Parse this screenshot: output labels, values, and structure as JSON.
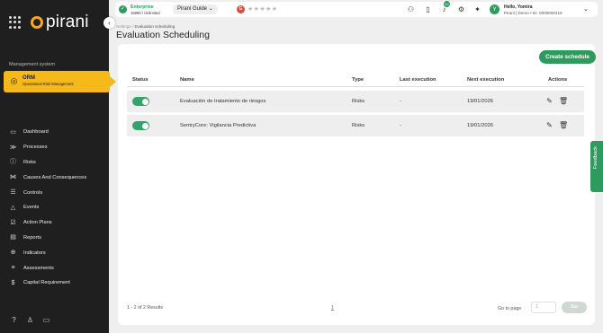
{
  "brand": {
    "name": "pirani"
  },
  "sidebar": {
    "section_label": "Management system",
    "active_module": {
      "title": "ORM",
      "subtitle": "Operational Risk Management"
    },
    "items": [
      {
        "label": "Dashboard",
        "icon": "monitor-icon"
      },
      {
        "label": "Processes",
        "icon": "processes-icon"
      },
      {
        "label": "Risks",
        "icon": "alert-circle-icon"
      },
      {
        "label": "Causes And Consequences",
        "icon": "bowtie-icon"
      },
      {
        "label": "Controls",
        "icon": "sliders-icon"
      },
      {
        "label": "Events",
        "icon": "warning-triangle-icon"
      },
      {
        "label": "Action Plans",
        "icon": "checklist-icon"
      },
      {
        "label": "Reports",
        "icon": "report-icon"
      },
      {
        "label": "Indicators",
        "icon": "target-icon"
      },
      {
        "label": "Assessments",
        "icon": "assessment-icon"
      },
      {
        "label": "Capital Requirement",
        "icon": "coin-icon"
      }
    ]
  },
  "header": {
    "plan_title": "Enterprise",
    "plan_sub": "15990 / Unlimited",
    "guide_label": "Pirani Guide",
    "rating_badge": "G",
    "rating_stars": "★★★★★",
    "notification_count": "10",
    "avatar_letter": "Y",
    "user_hello": "Hello, Yomira",
    "user_sub": "Pirani | Demo • ID: 0000000419"
  },
  "page": {
    "breadcrumb_root": "Settings",
    "breadcrumb_current": "Evaluation scheduling",
    "title": "Evaluation Scheduling",
    "create_button": "Create schedule"
  },
  "table": {
    "columns": [
      "Status",
      "Name",
      "Type",
      "Last execution",
      "Next execution",
      "Actions"
    ],
    "rows": [
      {
        "enabled": true,
        "name": "Evaluación de tratamiento de riesgos",
        "type": "Risks",
        "last": "-",
        "next": "19/01/2026"
      },
      {
        "enabled": true,
        "name": "SentryCore: Vigilancia Predictiva",
        "type": "Risks",
        "last": "-",
        "next": "19/01/2026"
      }
    ]
  },
  "pagination": {
    "results": "1 - 2 of 2 Results",
    "current_page": "1",
    "goto_label": "Go to page",
    "goto_placeholder": "1",
    "go_button": "Go"
  },
  "feedback_label": "Feedback",
  "colors": {
    "accent": "#2e9a5e",
    "sidebar": "#1f1f1f",
    "active": "#f6b91a"
  }
}
